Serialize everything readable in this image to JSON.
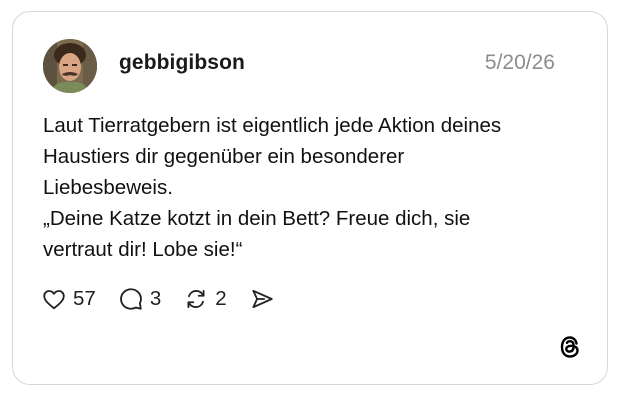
{
  "post": {
    "username": "gebbigibson",
    "date": "5/20/26",
    "lines": [
      "Laut Tierratgebern ist eigentlich jede Aktion deines",
      "Haustiers dir gegenüber ein besonderer",
      "Liebesbeweis.",
      "„Deine Katze kotzt in dein Bett? Freue dich, sie",
      "vertraut dir! Lobe sie!“"
    ]
  },
  "actions": {
    "likes": "57",
    "replies": "3",
    "reposts": "2"
  },
  "icons": {
    "like": "heart-icon",
    "reply": "speech-bubble-icon",
    "repost": "repost-arrows-icon",
    "share": "send-arrow-icon",
    "brand": "threads-logo-icon"
  },
  "colors": {
    "border": "#d6d6d6",
    "text": "#111111",
    "muted": "#8c8c8c"
  }
}
